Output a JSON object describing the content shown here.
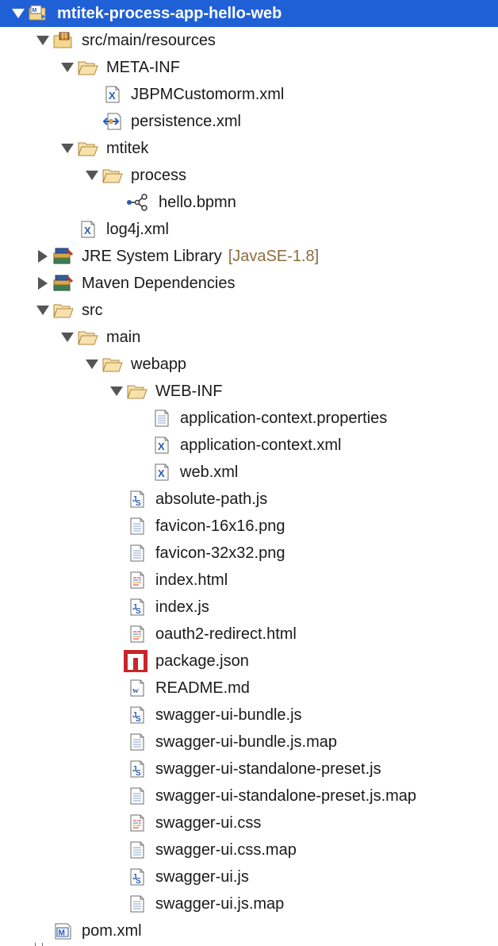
{
  "tree": [
    {
      "label": "mtitek-process-app-hello-web",
      "icon": "project-icon",
      "state": "expanded",
      "depth": 0,
      "selected": true
    },
    {
      "label": "src/main/resources",
      "icon": "source-folder-icon",
      "state": "expanded",
      "depth": 1
    },
    {
      "label": "META-INF",
      "icon": "folder-open-icon",
      "state": "expanded",
      "depth": 2
    },
    {
      "label": "JBPMCustomorm.xml",
      "icon": "xml-file-icon",
      "state": "leaf",
      "depth": 3
    },
    {
      "label": "persistence.xml",
      "icon": "persistence-file-icon",
      "state": "leaf",
      "depth": 3
    },
    {
      "label": "mtitek",
      "icon": "folder-open-icon",
      "state": "expanded",
      "depth": 2
    },
    {
      "label": "process",
      "icon": "folder-open-icon",
      "state": "expanded",
      "depth": 3
    },
    {
      "label": "hello.bpmn",
      "icon": "bpmn-file-icon",
      "state": "leaf",
      "depth": 4
    },
    {
      "label": "log4j.xml",
      "icon": "xml-file-icon",
      "state": "leaf",
      "depth": 2
    },
    {
      "label": "JRE System Library",
      "decoration": "[JavaSE-1.8]",
      "icon": "library-icon",
      "state": "collapsed",
      "depth": 1
    },
    {
      "label": "Maven Dependencies",
      "icon": "library-icon",
      "state": "collapsed",
      "depth": 1
    },
    {
      "label": "src",
      "icon": "folder-open-icon",
      "state": "expanded",
      "depth": 1
    },
    {
      "label": "main",
      "icon": "folder-open-icon",
      "state": "expanded",
      "depth": 2
    },
    {
      "label": "webapp",
      "icon": "folder-open-icon",
      "state": "expanded",
      "depth": 3
    },
    {
      "label": "WEB-INF",
      "icon": "folder-open-icon",
      "state": "expanded",
      "depth": 4
    },
    {
      "label": "application-context.properties",
      "icon": "text-file-icon",
      "state": "leaf",
      "depth": 5
    },
    {
      "label": "application-context.xml",
      "icon": "xml-file-icon",
      "state": "leaf",
      "depth": 5
    },
    {
      "label": "web.xml",
      "icon": "xml-file-icon",
      "state": "leaf",
      "depth": 5
    },
    {
      "label": "absolute-path.js",
      "icon": "js-file-icon",
      "state": "leaf",
      "depth": 4
    },
    {
      "label": "favicon-16x16.png",
      "icon": "text-file-icon",
      "state": "leaf",
      "depth": 4
    },
    {
      "label": "favicon-32x32.png",
      "icon": "text-file-icon",
      "state": "leaf",
      "depth": 4
    },
    {
      "label": "index.html",
      "icon": "html-file-icon",
      "state": "leaf",
      "depth": 4
    },
    {
      "label": "index.js",
      "icon": "js-file-icon",
      "state": "leaf",
      "depth": 4
    },
    {
      "label": "oauth2-redirect.html",
      "icon": "html-file-icon",
      "state": "leaf",
      "depth": 4
    },
    {
      "label": "package.json",
      "icon": "npm-file-icon",
      "state": "leaf",
      "depth": 4
    },
    {
      "label": "README.md",
      "icon": "word-file-icon",
      "state": "leaf",
      "depth": 4
    },
    {
      "label": "swagger-ui-bundle.js",
      "icon": "js-file-icon",
      "state": "leaf",
      "depth": 4
    },
    {
      "label": "swagger-ui-bundle.js.map",
      "icon": "text-file-icon",
      "state": "leaf",
      "depth": 4
    },
    {
      "label": "swagger-ui-standalone-preset.js",
      "icon": "js-file-icon",
      "state": "leaf",
      "depth": 4
    },
    {
      "label": "swagger-ui-standalone-preset.js.map",
      "icon": "text-file-icon",
      "state": "leaf",
      "depth": 4
    },
    {
      "label": "swagger-ui.css",
      "icon": "html-file-icon",
      "state": "leaf",
      "depth": 4
    },
    {
      "label": "swagger-ui.css.map",
      "icon": "text-file-icon",
      "state": "leaf",
      "depth": 4
    },
    {
      "label": "swagger-ui.js",
      "icon": "js-file-icon",
      "state": "leaf",
      "depth": 4
    },
    {
      "label": "swagger-ui.js.map",
      "icon": "text-file-icon",
      "state": "leaf",
      "depth": 4
    },
    {
      "label": "pom.xml",
      "icon": "maven-pom-icon",
      "state": "leaf",
      "depth": 1
    }
  ],
  "colors": {
    "selection": "#1f60d6",
    "decoration": "#8c6d3e",
    "folder": "#f2d49a"
  }
}
